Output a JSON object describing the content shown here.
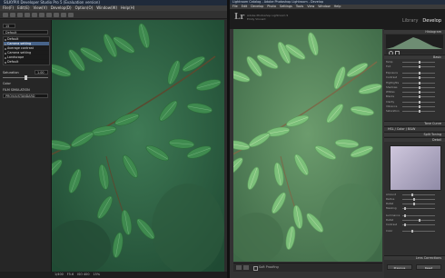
{
  "silkypix": {
    "title": "SILKYPIX Developer Studio Pro 5 (Evaluation version)",
    "menu": [
      "File(F)",
      "Edit(E)",
      "View(V)",
      "Develop(D)",
      "Option(O)",
      "Window(W)",
      "Help(H)"
    ],
    "zoom_value": "15",
    "taste_select": "Default",
    "presets": [
      {
        "label": "Default",
        "selected": false
      },
      {
        "label": "Camera setting",
        "selected": true
      },
      {
        "label": "Average contrast",
        "selected": false
      },
      {
        "label": "Camera setting",
        "selected": false
      },
      {
        "label": "Landscape",
        "selected": false
      },
      {
        "label": "Default",
        "selected": false
      }
    ],
    "saturation_label": "Saturation",
    "saturation_value": "1.00",
    "color_label": "Color",
    "film_simulation_label": "FILM SIMULATION",
    "film_simulation_value": "PROVIA/STANDARD",
    "status": [
      "1/400",
      "F5.6",
      "ISO 400",
      "15%"
    ]
  },
  "lightroom": {
    "title": "Lightroom Catalog - Adobe Photoshop Lightroom - Develop",
    "menu": [
      "File",
      "Edit",
      "Develop",
      "Photo",
      "Settings",
      "Tools",
      "View",
      "Window",
      "Help"
    ],
    "logo": "Lr",
    "identity": "Adobe Photoshop Lightroom 5",
    "user": "Emily Vincent",
    "modules": {
      "library": "Library",
      "develop": "Develop"
    },
    "panels": {
      "histogram": "Histogram",
      "basic": "Basic",
      "tone_curve": "Tone Curve",
      "hsl": "HSL / Color / B&W",
      "split_toning": "Split Toning",
      "detail": "Detail",
      "lens_corrections": "Lens Corrections"
    },
    "basic_rows": [
      "Temp",
      "Tint",
      "Exposure",
      "Contrast",
      "Highlights",
      "Shadows",
      "Whites",
      "Blacks",
      "Clarity",
      "Vibrance",
      "Saturation"
    ],
    "detail_rows": [
      "Amount",
      "Radius",
      "Detail",
      "Masking",
      "Luminance",
      "Detail",
      "Contrast",
      "Color"
    ],
    "soft_proofing_label": "Soft Proofing",
    "previous_label": "Previous",
    "reset_label": "Reset"
  },
  "colors": {
    "leaf_left": "#3f8a4f",
    "leaf_right": "#7cc07a",
    "bg_left": "#2f6b48",
    "bg_right": "#5e8f62"
  }
}
